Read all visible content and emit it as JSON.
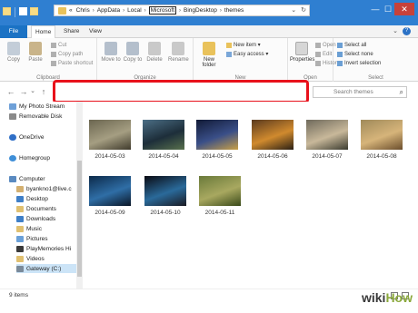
{
  "window": {
    "title": "themes",
    "minimize": "—",
    "maximize": "☐",
    "close": "✕"
  },
  "tabs": {
    "file": "File",
    "home": "Home",
    "share": "Share",
    "view": "View",
    "chevron": "⌄",
    "help": "?"
  },
  "ribbon": {
    "copy": "Copy",
    "paste": "Paste",
    "cut": "Cut",
    "copy_path": "Copy path",
    "paste_shortcut": "Paste shortcut",
    "clipboard_label": "Clipboard",
    "move_to": "Move to",
    "copy_to": "Copy to",
    "delete": "Delete",
    "rename": "Rename",
    "organize_label": "Organize",
    "new_folder": "New folder",
    "new_item": "New item ▾",
    "easy_access": "Easy access ▾",
    "new_label": "New",
    "properties": "Properties",
    "open": "Open ▾",
    "edit": "Edit",
    "history": "History",
    "open_label": "Open",
    "select_all": "Select all",
    "select_none": "Select none",
    "invert_selection": "Invert selection",
    "select_label": "Select"
  },
  "nav": {
    "back": "←",
    "forward": "→",
    "recent": "⌄",
    "up": "↑",
    "overflow": "«",
    "crumbs": [
      "Chris",
      "AppData",
      "Local",
      "Microsoft",
      "BingDesktop",
      "themes"
    ],
    "dropdown": "⌄",
    "refresh": "↻",
    "search_placeholder": "Search themes",
    "search_icon": "⌕"
  },
  "sidebar": {
    "items": [
      "My Photo Stream",
      "Removable Disk",
      "OneDrive",
      "Homegroup",
      "Computer",
      "byankno1@live.c",
      "Desktop",
      "Documents",
      "Downloads",
      "Music",
      "Pictures",
      "PlayMemories Hi",
      "Videos",
      "Gateway (C:)"
    ]
  },
  "files": [
    {
      "name": "2014-05-03",
      "colors": [
        "#6b6650",
        "#a59e82",
        "#3f3a2c"
      ]
    },
    {
      "name": "2014-05-04",
      "colors": [
        "#4c6f86",
        "#1d2e3a",
        "#58704c"
      ]
    },
    {
      "name": "2014-05-05",
      "colors": [
        "#111a36",
        "#3a4f88",
        "#c9a046"
      ]
    },
    {
      "name": "2014-05-06",
      "colors": [
        "#5a3a1e",
        "#d08a2e",
        "#2a1f14"
      ]
    },
    {
      "name": "2014-05-07",
      "colors": [
        "#6f6a5c",
        "#c8b89a",
        "#3a3a2e"
      ]
    },
    {
      "name": "2014-05-08",
      "colors": [
        "#a08a5a",
        "#d6b47a",
        "#6a4d2c"
      ]
    },
    {
      "name": "2014-05-09",
      "colors": [
        "#0c2a4a",
        "#2f6ea6",
        "#0a1626"
      ]
    },
    {
      "name": "2014-05-10",
      "colors": [
        "#0a0a12",
        "#2a6a9a",
        "#1a1a22"
      ]
    },
    {
      "name": "2014-05-11",
      "colors": [
        "#6a7a3a",
        "#a8a860",
        "#3a4a1a"
      ]
    }
  ],
  "status": {
    "count": "9 items"
  },
  "watermark": {
    "part1": "wiki",
    "part2": "How"
  }
}
